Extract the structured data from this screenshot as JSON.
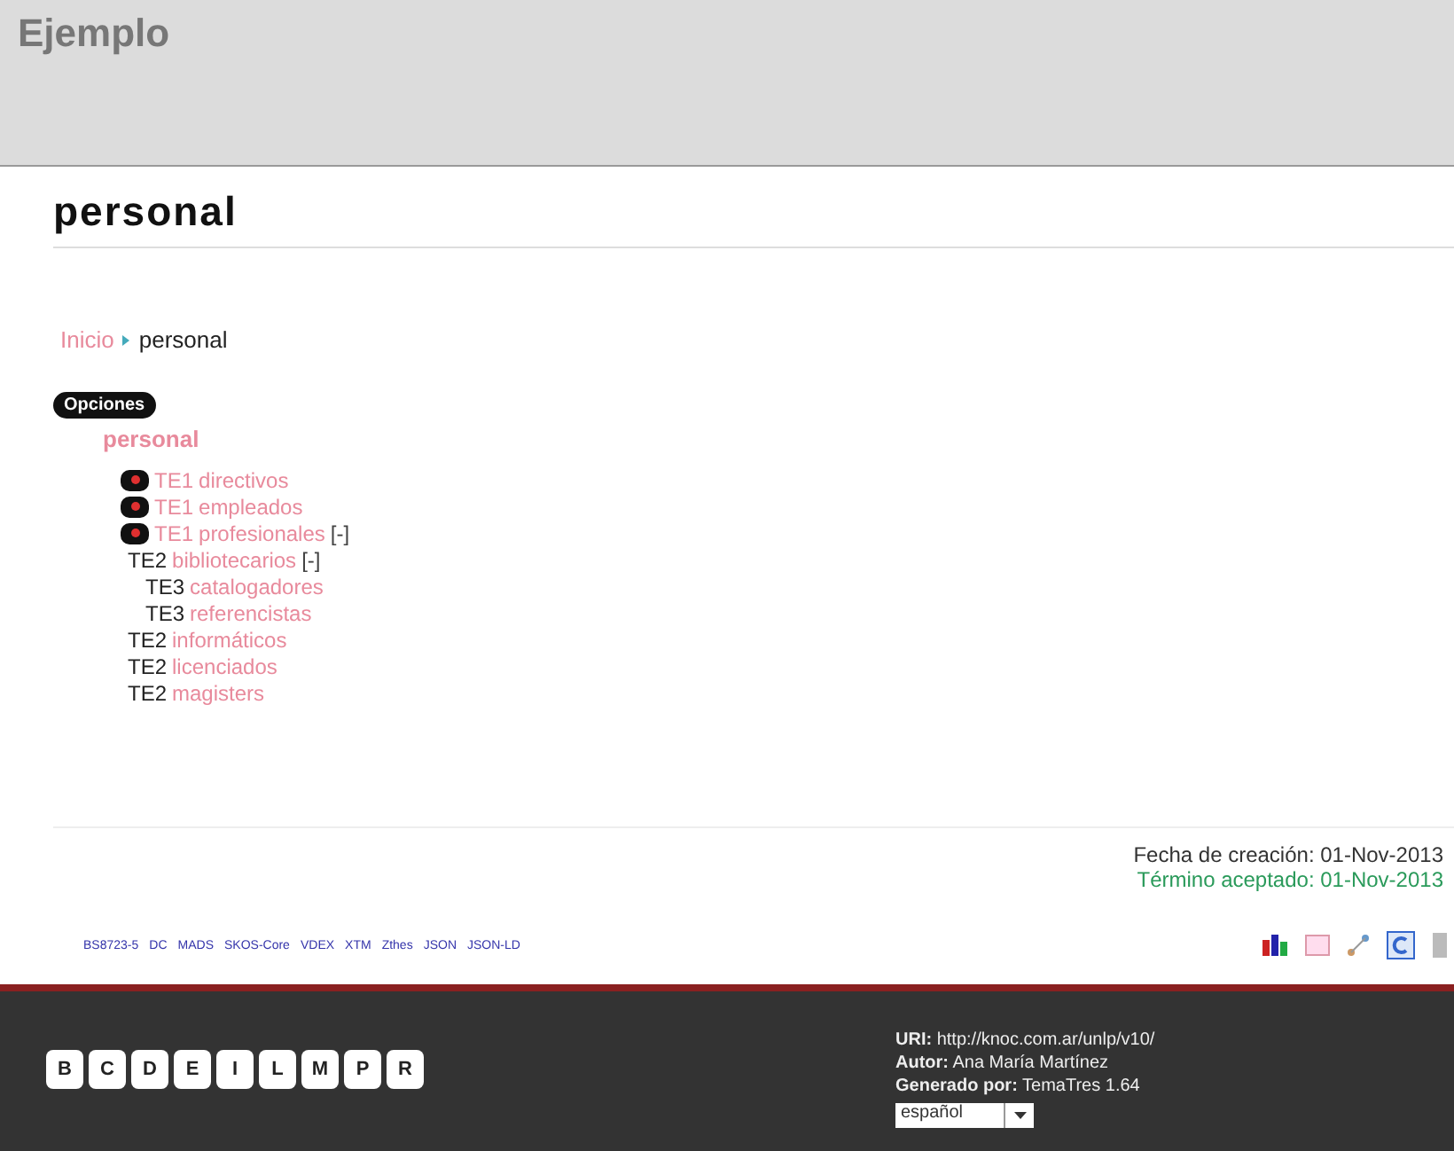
{
  "site_title": "Ejemplo",
  "term_title": "personal",
  "breadcrumb": [
    {
      "label": "Inicio",
      "kind": "link"
    },
    {
      "label": "personal",
      "kind": "current"
    }
  ],
  "options_button": "Opciones",
  "tree": {
    "label": "personal",
    "children": [
      {
        "prefix": "TE1",
        "label": "directivos",
        "removable": true
      },
      {
        "prefix": "TE1",
        "label": "empleados",
        "removable": true
      },
      {
        "prefix": "TE1",
        "label": "profesionales",
        "removable": true,
        "toggle": "[-]",
        "children": [
          {
            "prefix": "TE2",
            "label": "bibliotecarios",
            "removable": false,
            "toggle": "[-]",
            "children": [
              {
                "prefix": "TE3",
                "label": "catalogadores",
                "removable": false
              },
              {
                "prefix": "TE3",
                "label": "referencistas",
                "removable": false
              }
            ]
          },
          {
            "prefix": "TE2",
            "label": "informáticos",
            "removable": false
          },
          {
            "prefix": "TE2",
            "label": "licenciados",
            "removable": false
          },
          {
            "prefix": "TE2",
            "label": "magisters",
            "removable": false
          }
        ]
      }
    ]
  },
  "dates": [
    {
      "label": "Fecha de creación: 01-Nov-2013",
      "kind": "created"
    },
    {
      "label": "Término aceptado: 01-Nov-2013",
      "kind": "accepted"
    }
  ],
  "formats": [
    "BS8723-5",
    "DC",
    "MADS",
    "SKOS-Core",
    "VDEX",
    "XTM",
    "Zthes",
    "JSON",
    "JSON-LD"
  ],
  "letters": [
    "B",
    "C",
    "D",
    "E",
    "I",
    "L",
    "M",
    "P",
    "R"
  ],
  "footer": {
    "uri_label": "URI:",
    "uri": "http://knoc.com.ar/unlp/v10/",
    "author_label": "Autor:",
    "author": "Ana María Martínez",
    "generated_label": "Generado por:",
    "generator": "TemaTres 1.64",
    "language": "español"
  }
}
